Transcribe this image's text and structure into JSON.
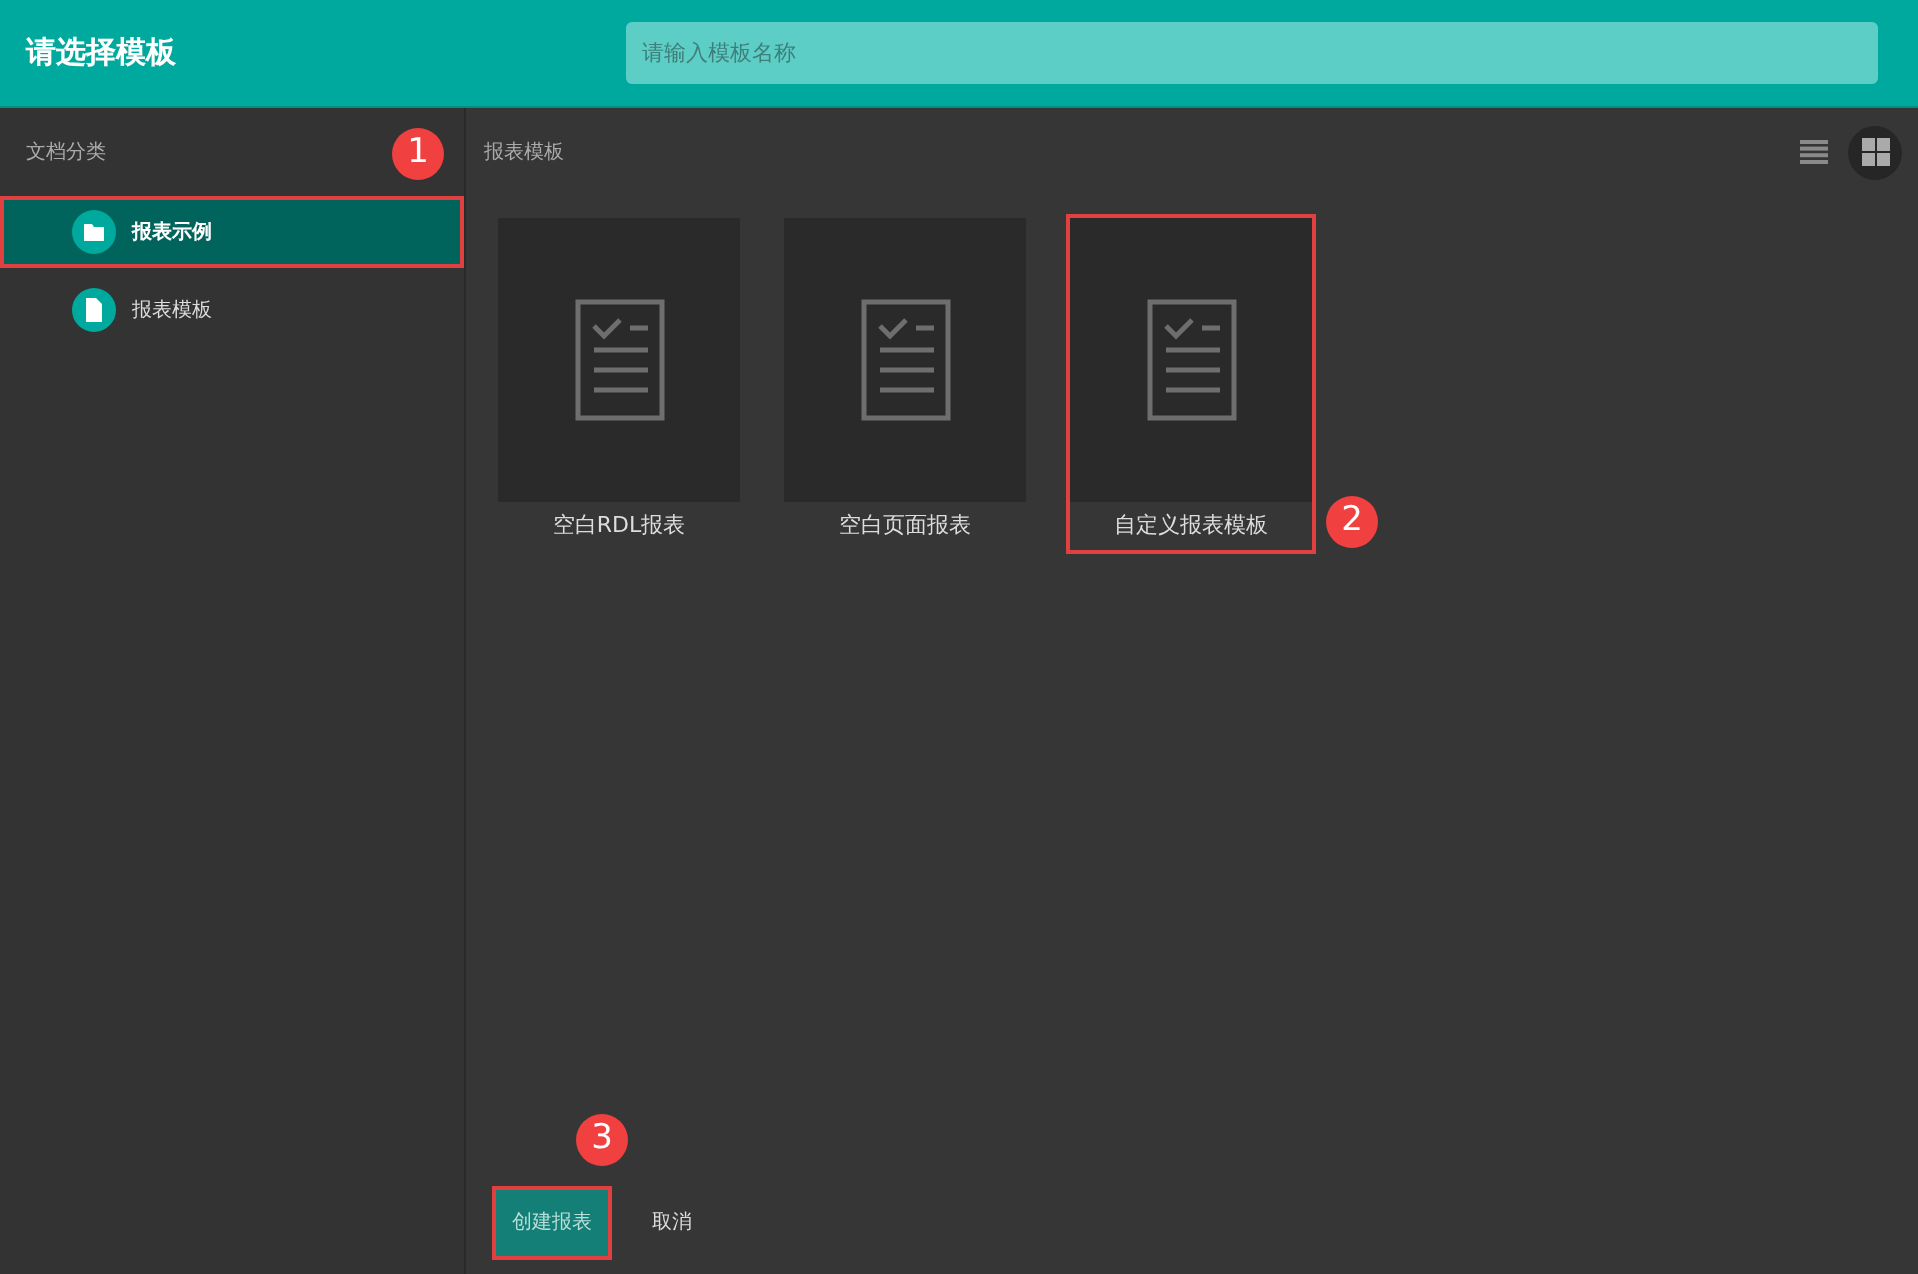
{
  "header": {
    "title": "请选择模板",
    "search": {
      "placeholder": "请输入模板名称"
    }
  },
  "sidebar": {
    "heading": "文档分类",
    "callout": "1",
    "items": [
      {
        "label": "报表示例",
        "kind": "folder",
        "selected": true,
        "marked": true
      },
      {
        "label": "报表模板",
        "kind": "file",
        "selected": false,
        "marked": false
      }
    ]
  },
  "main": {
    "heading": "报表模板",
    "views": [
      {
        "kind": "list",
        "selected": false
      },
      {
        "kind": "grid",
        "selected": true
      }
    ],
    "templates": [
      {
        "label": "空白RDL报表",
        "marked": false
      },
      {
        "label": "空白页面报表",
        "marked": false
      },
      {
        "label": "自定义报表模板",
        "marked": true,
        "callout": "2"
      }
    ]
  },
  "buttons": [
    {
      "label": "创建报表",
      "kind": "primary",
      "marked": true,
      "callout": "3"
    },
    {
      "label": "取消",
      "kind": "plain",
      "marked": false
    }
  ]
}
